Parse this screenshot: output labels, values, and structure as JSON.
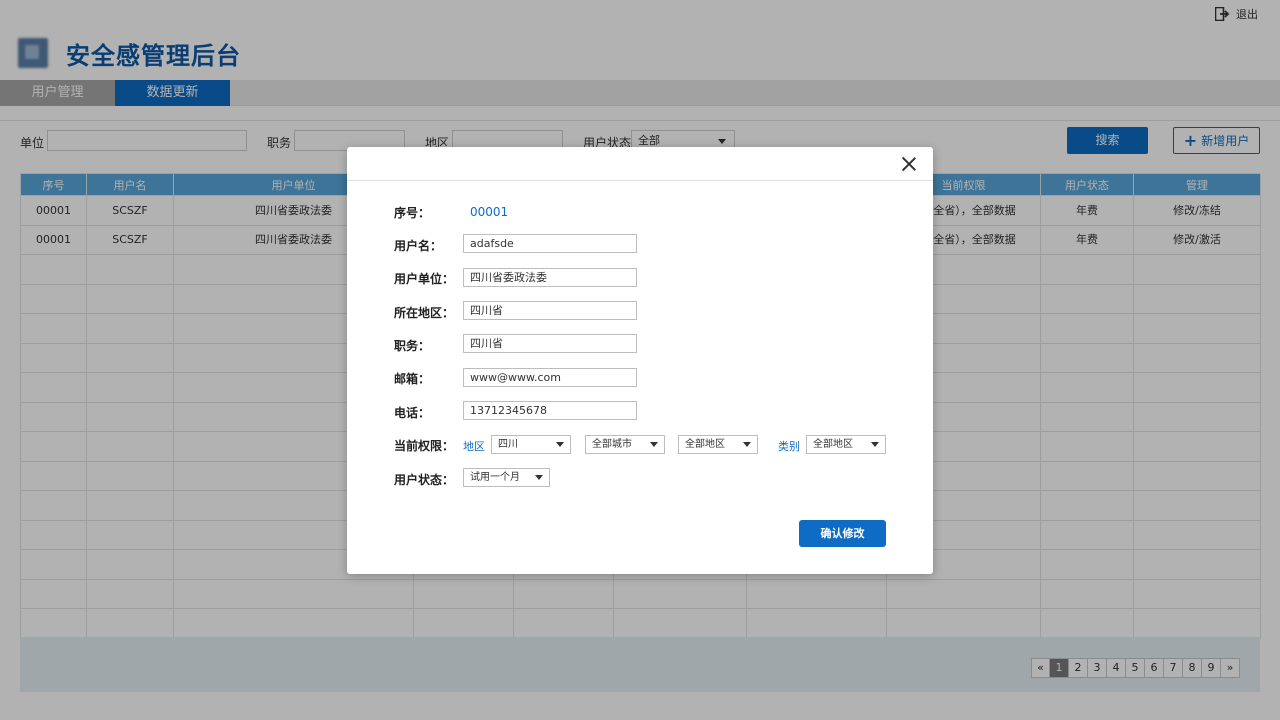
{
  "header": {
    "app_title": "安全感管理后台",
    "logout_label": "退出",
    "logout_icon": "logout-icon",
    "logo_icon": "logo-icon"
  },
  "tabs": [
    {
      "label": "用户管理",
      "active": false
    },
    {
      "label": "数据更新",
      "active": true
    }
  ],
  "filters": {
    "unit_label": "单位",
    "unit_value": "",
    "position_label": "职务",
    "position_value": "",
    "region_label": "地区",
    "region_value": "",
    "status_label": "用户状态",
    "status_value": "全部",
    "search_button": "搜索",
    "add_user_button": "新增用户"
  },
  "table": {
    "headers": [
      "序号",
      "用户名",
      "用户单位",
      "",
      "",
      "",
      "",
      "当前权限",
      "用户状态",
      "管理"
    ],
    "rows": [
      [
        "00001",
        "SCSZF",
        "四川省委政法委",
        "",
        "",
        "",
        "",
        "省（全省），全部数据",
        "年费",
        "修改/冻结"
      ],
      [
        "00001",
        "SCSZF",
        "四川省委政法委",
        "",
        "",
        "",
        "",
        "省（全省），全部数据",
        "年费",
        "修改/激活"
      ]
    ],
    "empty_rows": 13
  },
  "pagination": {
    "prev": "«",
    "next": "»",
    "pages": [
      "1",
      "2",
      "3",
      "4",
      "5",
      "6",
      "7",
      "8",
      "9"
    ],
    "current": "1"
  },
  "modal": {
    "close_icon": "close-icon",
    "id_label": "序号：",
    "id_value": "00001",
    "username_label": "用户名：",
    "username_value": "adafsde",
    "unit_label": "用户单位：",
    "unit_value": "四川省委政法委",
    "region_label": "所在地区：",
    "region_value": "四川省",
    "position_label": "职务：",
    "position_value": "四川省",
    "email_label": "邮箱：",
    "email_value": "www@www.com",
    "phone_label": "电话：",
    "phone_value": "13712345678",
    "permission_label": "当前权限：",
    "perm_region_hint": "地区",
    "perm_province": "四川",
    "perm_city": "全部城市",
    "perm_district": "全部地区",
    "perm_category_hint": "类别",
    "perm_category": "全部地区",
    "status_label": "用户状态：",
    "status_value": "试用一个月",
    "confirm_button": "确认修改"
  },
  "colors": {
    "primary": "#0e6cc4",
    "table_header": "#5aa6d8",
    "overlay": "rgba(0,0,0,0.30)"
  }
}
